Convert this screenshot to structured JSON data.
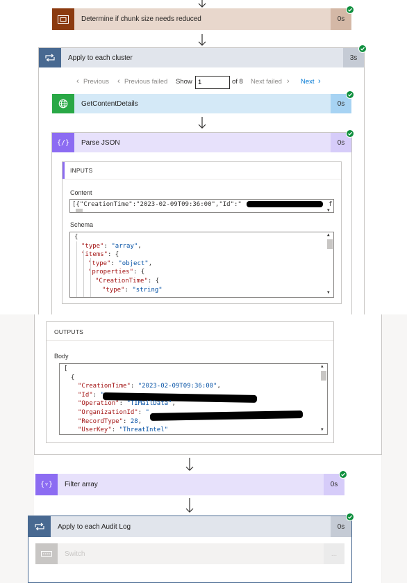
{
  "flow": {
    "determine": {
      "title": "Determine if chunk size needs reduced",
      "duration": "0s",
      "colors": {
        "icon": "#8b3a0f",
        "bar": "#e8d7cc",
        "dur": "#d4b8a6"
      }
    },
    "apply_cluster": {
      "title": "Apply to each cluster",
      "duration": "3s"
    },
    "pager": {
      "previous": "Previous",
      "previous_failed": "Previous failed",
      "show": "Show",
      "value": "1",
      "of": "of 8",
      "next_failed": "Next failed",
      "next": "Next"
    },
    "get_content": {
      "title": "GetContentDetails",
      "duration": "0s"
    },
    "parse_json": {
      "title": "Parse JSON",
      "duration": "0s",
      "icon_text": "{/}",
      "inputs": {
        "header": "INPUTS",
        "content_label": "Content",
        "content_value": "[{\"CreationTime\":\"2023-02-09T09:36:00\",\"Id\":\"",
        "content_suffix": "f",
        "schema_label": "Schema",
        "schema_lines": [
          {
            "text": "{",
            "indent": 0
          },
          {
            "key": "\"type\"",
            "val": "\"array\"",
            "trail": ",",
            "indent": 1
          },
          {
            "key": "\"items\"",
            "trail": ": {",
            "indent": 1
          },
          {
            "key": "\"type\"",
            "val": "\"object\"",
            "trail": ",",
            "indent": 2
          },
          {
            "key": "\"properties\"",
            "trail": ": {",
            "indent": 2
          },
          {
            "key": "\"CreationTime\"",
            "trail": ": {",
            "indent": 3
          },
          {
            "key": "\"type\"",
            "val": "\"string\"",
            "indent": 4
          }
        ]
      },
      "outputs": {
        "header": "OUTPUTS",
        "body_label": "Body",
        "lines": [
          {
            "text": "[",
            "indent": 0
          },
          {
            "text": "{",
            "indent": 1
          },
          {
            "key": "\"CreationTime\"",
            "val": "\"2023-02-09T09:36:00\"",
            "trail": ",",
            "indent": 2
          },
          {
            "key": "\"Id\"",
            "val": "\"",
            "indent": 2
          },
          {
            "key": "\"Operation\"",
            "val": "\"TIMailData\"",
            "trail": ",",
            "indent": 2
          },
          {
            "key": "\"OrganizationId\"",
            "val": "\"",
            "indent": 2
          },
          {
            "key": "\"RecordType\"",
            "val": "28",
            "trail": ",",
            "indent": 2
          },
          {
            "key": "\"UserKey\"",
            "val": "\"ThreatIntel\"",
            "indent": 2
          }
        ]
      }
    },
    "filter_array": {
      "title": "Filter array",
      "duration": "0s",
      "icon_text": "{▿}"
    },
    "apply_audit": {
      "title": "Apply to each Audit Log",
      "duration": "0s"
    },
    "switch": {
      "title": "Switch",
      "more": "..."
    },
    "colors": {
      "loop_icon": "#486991",
      "loop_bar": "#e1e5ec",
      "loop_dur": "#c5cbd5",
      "http_icon": "#29a846",
      "http_bar": "#d4e9f7",
      "http_dur": "#a7d3f3",
      "data_icon": "#8c6cf2",
      "data_bar": "#e7e1fb",
      "data_dur": "#d6ccf9",
      "success": "#0f8f3e",
      "link": "#0078d4"
    }
  }
}
